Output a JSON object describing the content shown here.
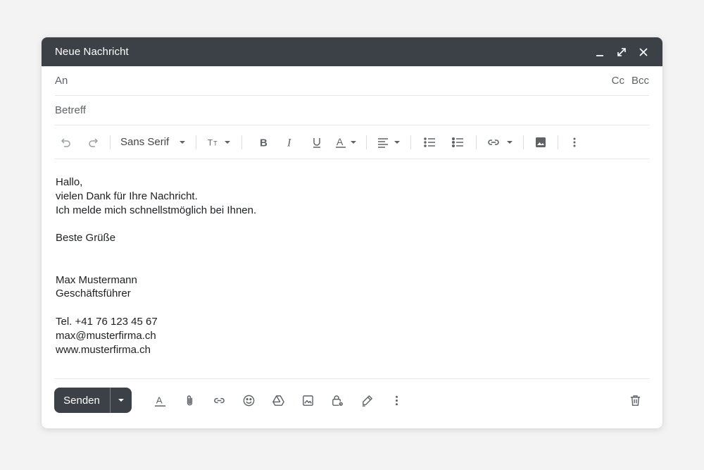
{
  "window": {
    "title": "Neue Nachricht"
  },
  "recipients": {
    "to_label": "An",
    "cc_label": "Cc",
    "bcc_label": "Bcc"
  },
  "subject": {
    "label": "Betreff"
  },
  "formatting": {
    "font_family": "Sans Serif",
    "icons": [
      "undo-icon",
      "redo-icon",
      "text-size-icon",
      "bold-icon",
      "italic-icon",
      "underline-icon",
      "text-color-icon",
      "align-icon",
      "numbered-list-icon",
      "bulleted-list-icon",
      "link-icon",
      "image-icon",
      "more-options-icon"
    ]
  },
  "message": {
    "lines": [
      "Hallo,",
      "vielen Dank für Ihre Nachricht.",
      "Ich melde mich schnellstmöglich bei Ihnen.",
      "",
      "Beste Grüße",
      "",
      "",
      "Max Mustermann",
      "Geschäftsführer",
      "",
      "Tel. +41 76 123 45 67",
      "max@musterfirma.ch",
      "www.musterfirma.ch"
    ]
  },
  "actions": {
    "send_label": "Senden",
    "icons": [
      "formatting-options-icon",
      "attachment-icon",
      "insert-link-icon",
      "emoji-icon",
      "drive-icon",
      "insert-photo-icon",
      "confidential-mode-icon",
      "signature-icon",
      "more-options-icon",
      "trash-icon"
    ]
  },
  "colors": {
    "titlebar": "#3c4148",
    "send_button": "#3c4148",
    "background": "#f3f3f4"
  }
}
